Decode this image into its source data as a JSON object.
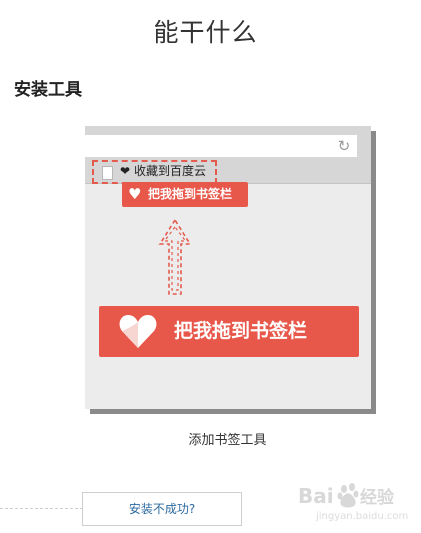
{
  "page": {
    "title": "能干什么"
  },
  "section": {
    "title": "安装工具"
  },
  "illustration": {
    "bookmark_label": "收藏到百度云",
    "small_button_label": "把我拖到书签栏",
    "big_button_label": "把我拖到书签栏",
    "accent_color": "#e8584a"
  },
  "caption": "添加书签工具",
  "help_button": {
    "label": "安装不成功?"
  }
}
